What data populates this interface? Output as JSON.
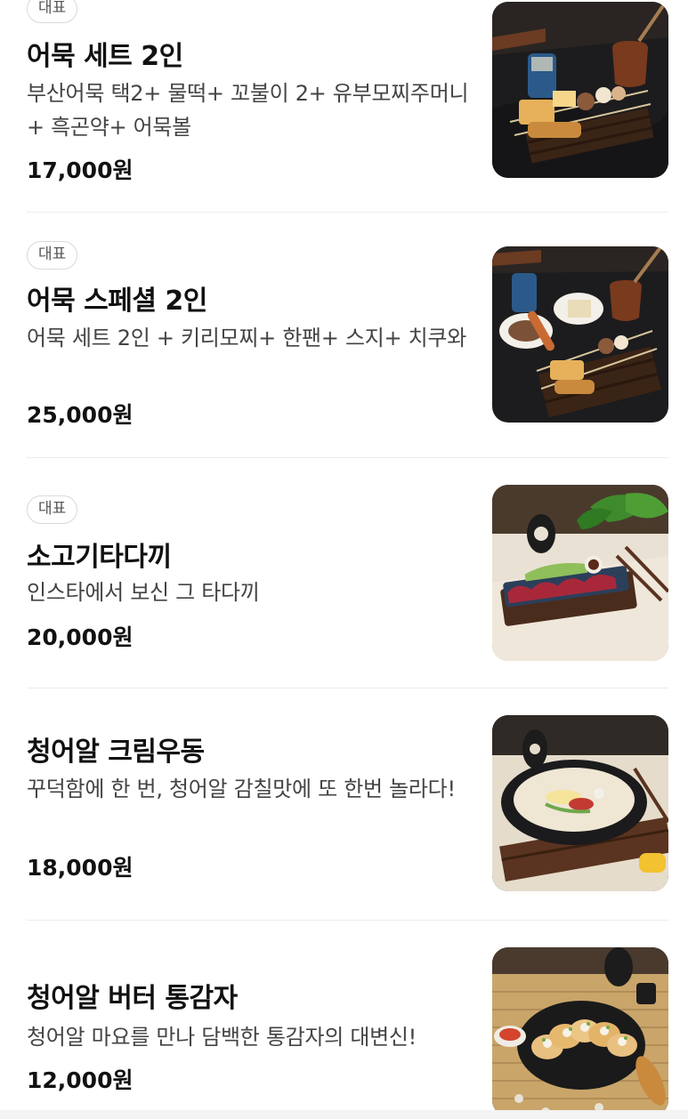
{
  "menu": {
    "items": [
      {
        "badge": "대표",
        "name": "어묵 세트 2인",
        "description": "부산어묵 택2+ 물떡+ 꼬불이 2+ 유부모찌주머니+ 흑곤약+ 어묵볼",
        "price": "17,000원",
        "image_icon": "fishcake-skewer-set-photo"
      },
      {
        "badge": "대표",
        "name": "어묵 스페셜 2인",
        "description": "어묵 세트 2인 + 키리모찌+ 한팬+ 스지+ 치쿠와",
        "price": "25,000원",
        "image_icon": "fishcake-special-photo"
      },
      {
        "badge": "대표",
        "name": "소고기타다끼",
        "description": "인스타에서 보신 그 타다끼",
        "price": "20,000원",
        "image_icon": "beef-tataki-photo"
      },
      {
        "badge": "",
        "name": "청어알 크림우동",
        "description": "꾸덕함에 한 번, 청어알 감칠맛에 또 한번 놀라다!",
        "price": "18,000원",
        "image_icon": "cream-udon-photo"
      },
      {
        "badge": "",
        "name": "청어알 버터 통감자",
        "description": "청어알 마요를 만나 담백한 통감자의 대변신!",
        "price": "12,000원",
        "image_icon": "butter-potato-photo"
      }
    ]
  }
}
